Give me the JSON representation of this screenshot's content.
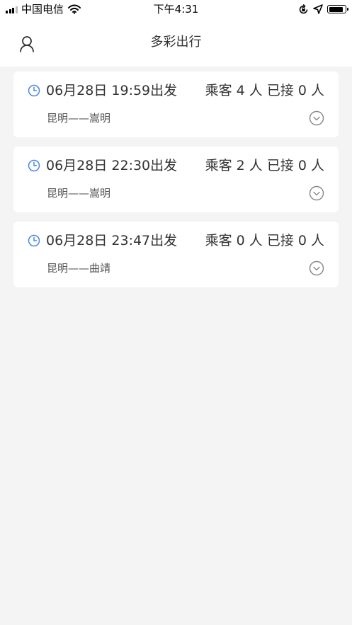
{
  "status_bar": {
    "carrier": "中国电信",
    "time": "下午4:31"
  },
  "header": {
    "title": "多彩出行",
    "left_icon": "user-icon"
  },
  "trips": [
    {
      "time": "06月28日 19:59出发",
      "passengers": "乘客 4 人 已接 0 人",
      "route": "昆明——嵩明"
    },
    {
      "time": "06月28日 22:30出发",
      "passengers": "乘客 2 人 已接 0 人",
      "route": "昆明——嵩明"
    },
    {
      "time": "06月28日 23:47出发",
      "passengers": "乘客 0 人 已接 0 人",
      "route": "昆明——曲靖"
    }
  ],
  "colors": {
    "background": "#f4f4f4",
    "card": "#ffffff",
    "clock_accent": "#4a86e8",
    "text": "#333333"
  }
}
